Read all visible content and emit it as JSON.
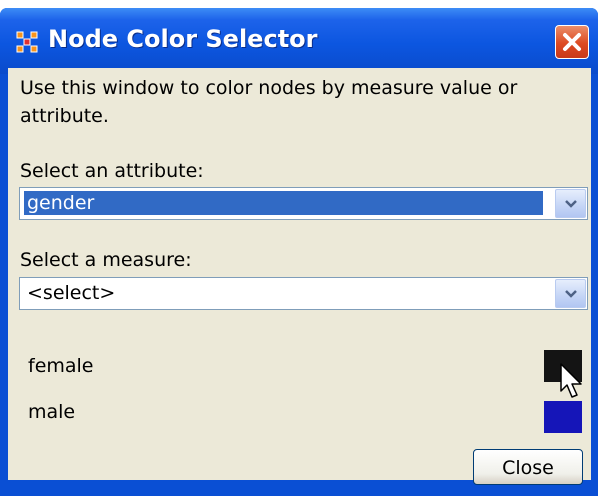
{
  "window": {
    "title": "Node Color Selector"
  },
  "intro_text": "Use this window to color nodes by measure value or attribute.",
  "attribute": {
    "label": "Select an attribute:",
    "value": "gender"
  },
  "measure": {
    "label": "Select a measure:",
    "value": "<select>"
  },
  "legend": [
    {
      "label": "female",
      "color": "#141414"
    },
    {
      "label": "male",
      "color": "#1515b8"
    }
  ],
  "buttons": {
    "close": "Close"
  },
  "icons": {
    "app": "node-grid-icon",
    "title_close": "close-icon",
    "dropdown": "chevron-down-icon",
    "pointer": "mouse-pointer-icon"
  }
}
